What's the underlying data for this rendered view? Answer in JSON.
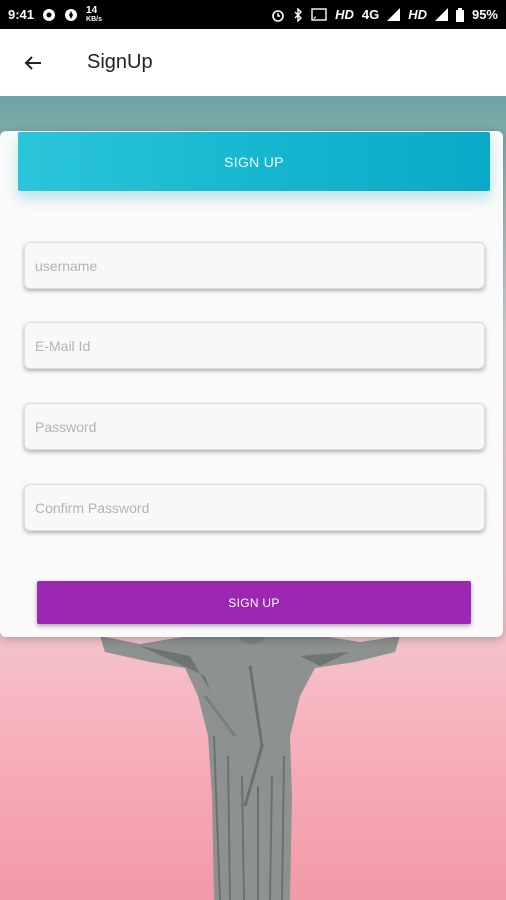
{
  "status_bar": {
    "time": "9:41",
    "net_speed_value": "14",
    "net_speed_unit": "KB/s",
    "hd1": "HD",
    "network": "4G",
    "hd2": "HD",
    "battery": "95%"
  },
  "app_bar": {
    "title": "SignUp"
  },
  "card": {
    "header_label": "SIGN UP",
    "fields": {
      "username_placeholder": "username",
      "email_placeholder": "E-Mail Id",
      "password_placeholder": "Password",
      "confirm_placeholder": "Confirm Password"
    },
    "submit_label": "SIGN UP"
  }
}
